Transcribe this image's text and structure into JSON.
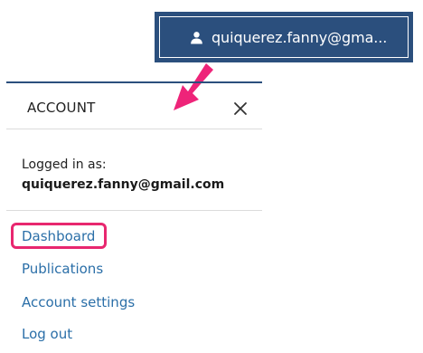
{
  "header": {
    "user_button_label": "quiquerez.fanny@gma..."
  },
  "panel": {
    "title": "ACCOUNT",
    "logged_in_label": "Logged in as:",
    "email": "quiquerez.fanny@gmail.com",
    "links": [
      {
        "label": "Dashboard"
      },
      {
        "label": "Publications"
      },
      {
        "label": "Account settings"
      },
      {
        "label": "Log out"
      }
    ]
  },
  "icons": {
    "user": "user-icon",
    "close": "close-icon",
    "arrow": "pointer-arrow-icon"
  },
  "colors": {
    "header_background": "#2b4f7d",
    "link": "#2b6fa8",
    "highlight": "#e8276f",
    "arrow": "#ee2479"
  }
}
